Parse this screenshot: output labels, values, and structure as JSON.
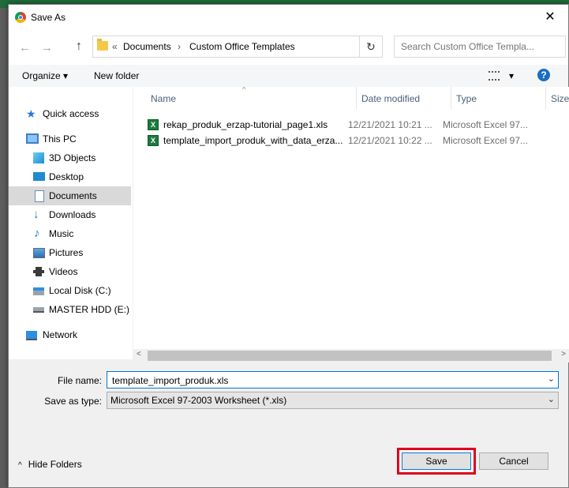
{
  "window": {
    "title": "Save As",
    "close_glyph": "✕"
  },
  "navigation": {
    "back_glyph": "←",
    "forward_glyph": "→",
    "up_glyph": "↑",
    "breadcrumb_prefix": "«",
    "breadcrumb": [
      "Documents",
      "Custom Office Templates"
    ],
    "separator": "›",
    "refresh_glyph": "↻",
    "search_placeholder": "Search Custom Office Templa..."
  },
  "toolbar": {
    "organize_label": "Organize ▾",
    "new_folder_label": "New folder",
    "view_caret": "▾",
    "help_glyph": "?"
  },
  "sidebar": {
    "items": [
      {
        "label": "Quick access",
        "icon": "star-icon"
      },
      {
        "label": "This PC",
        "icon": "computer-icon"
      },
      {
        "label": "3D Objects",
        "icon": "cube-icon"
      },
      {
        "label": "Desktop",
        "icon": "desktop-icon"
      },
      {
        "label": "Documents",
        "icon": "documents-icon",
        "selected": true
      },
      {
        "label": "Downloads",
        "icon": "download-icon"
      },
      {
        "label": "Music",
        "icon": "music-icon"
      },
      {
        "label": "Pictures",
        "icon": "pictures-icon"
      },
      {
        "label": "Videos",
        "icon": "videos-icon"
      },
      {
        "label": "Local Disk (C:)",
        "icon": "drive-icon"
      },
      {
        "label": "MASTER HDD (E:)",
        "icon": "drive-icon"
      },
      {
        "label": "Network",
        "icon": "network-icon"
      }
    ]
  },
  "file_list": {
    "columns": [
      "Name",
      "Date modified",
      "Type",
      "Size"
    ],
    "sort_glyph": "^",
    "rows": [
      {
        "name": "rekap_produk_erzap-tutorial_page1.xls",
        "date": "12/21/2021 10:21 ...",
        "type": "Microsoft Excel 97..."
      },
      {
        "name": "template_import_produk_with_data_erza...",
        "date": "12/21/2021 10:22 ...",
        "type": "Microsoft Excel 97..."
      }
    ],
    "file_icon_glyph": "X",
    "scroll_left": "<",
    "scroll_right": ">"
  },
  "form": {
    "file_name_label": "File name:",
    "file_name_value": "template_import_produk.xls",
    "save_as_type_label": "Save as type:",
    "save_as_type_value": "Microsoft Excel 97-2003 Worksheet (*.xls)",
    "dropdown_glyph": "⌄"
  },
  "footer": {
    "hide_folders_caret": "^",
    "hide_folders_label": "Hide Folders",
    "save_label": "Save",
    "cancel_label": "Cancel"
  },
  "colors": {
    "highlight_border": "#e0001b",
    "accent": "#0078d7"
  }
}
